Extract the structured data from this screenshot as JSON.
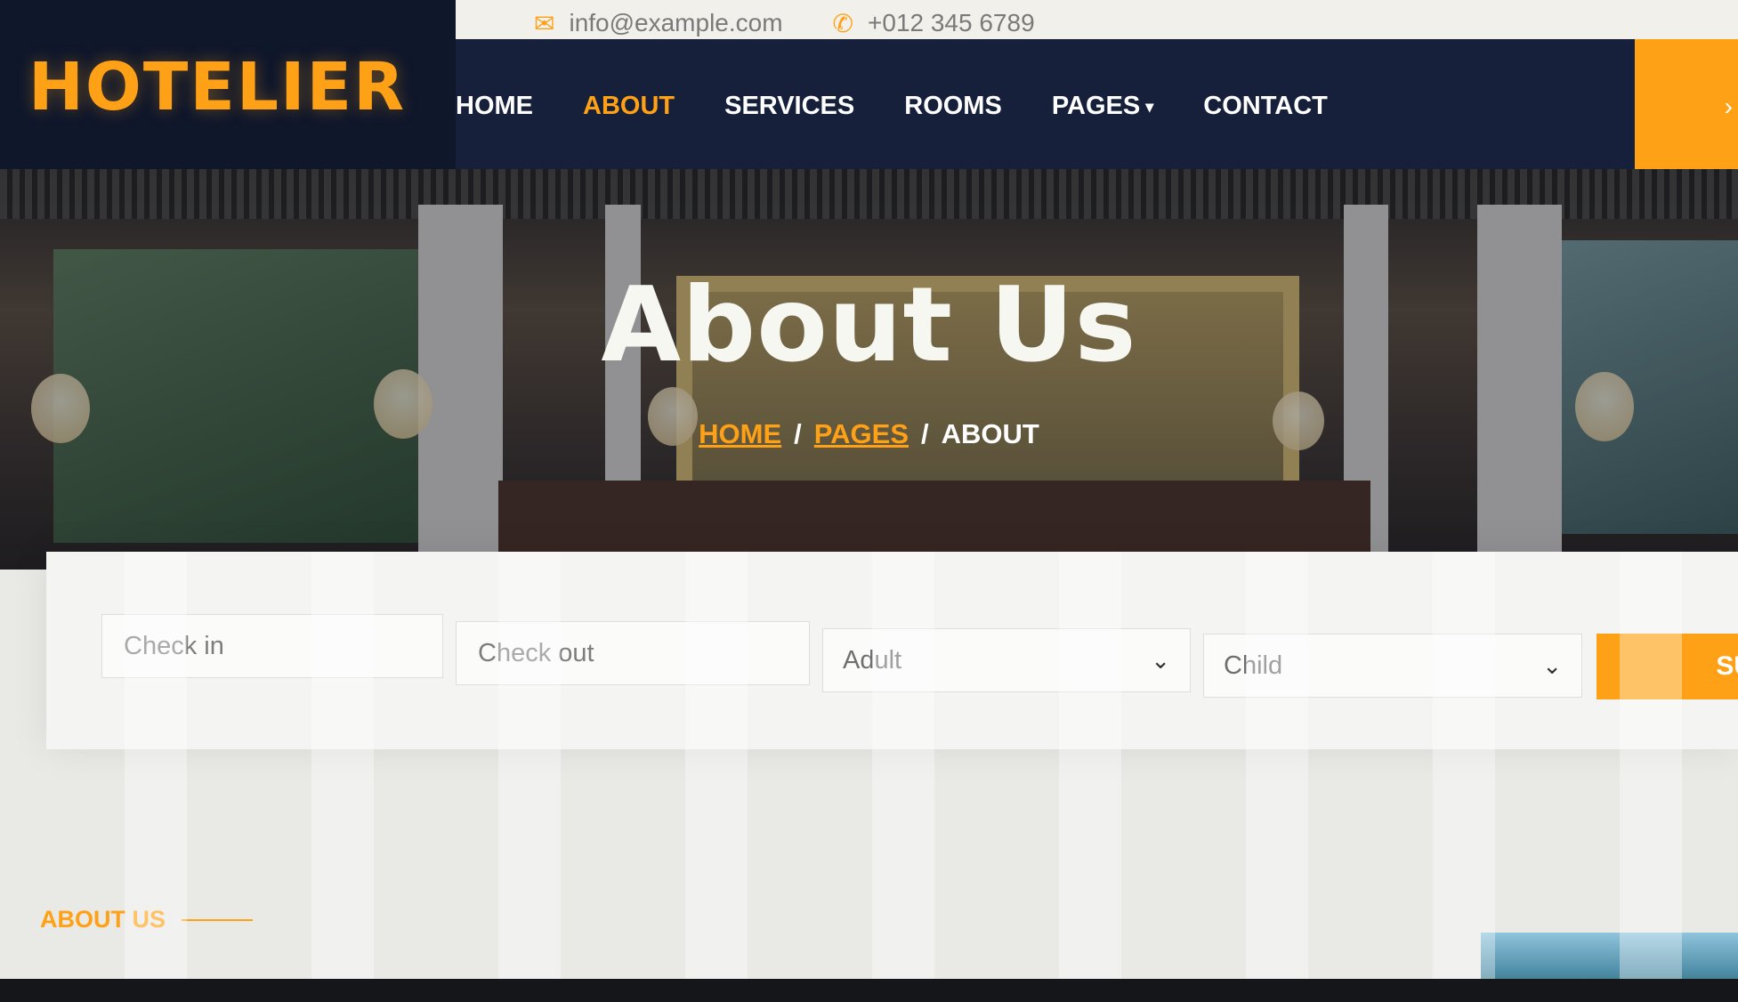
{
  "topbar": {
    "email": "info@example.com",
    "phone": "+012 345 6789",
    "email_icon": "envelope-icon",
    "phone_icon": "phone-icon"
  },
  "brand": {
    "logo": "HOTELIER"
  },
  "nav": {
    "items": [
      {
        "label": "HOME",
        "active": false
      },
      {
        "label": "ABOUT",
        "active": true
      },
      {
        "label": "SERVICES",
        "active": false
      },
      {
        "label": "ROOMS",
        "active": false
      },
      {
        "label": "PAGES",
        "active": false,
        "dropdown": true
      },
      {
        "label": "CONTACT",
        "active": false
      }
    ]
  },
  "hero": {
    "title": "About Us",
    "breadcrumb": [
      "HOME",
      "PAGES",
      "ABOUT"
    ]
  },
  "booking": {
    "checkin_placeholder": "Check in",
    "checkout_placeholder": "Check out",
    "adult_label": "Adult",
    "child_label": "Child",
    "submit_label": "SU"
  },
  "about": {
    "section_label": "ABOUT US"
  },
  "colors": {
    "accent": "#fea116",
    "dark": "#0f172b"
  }
}
